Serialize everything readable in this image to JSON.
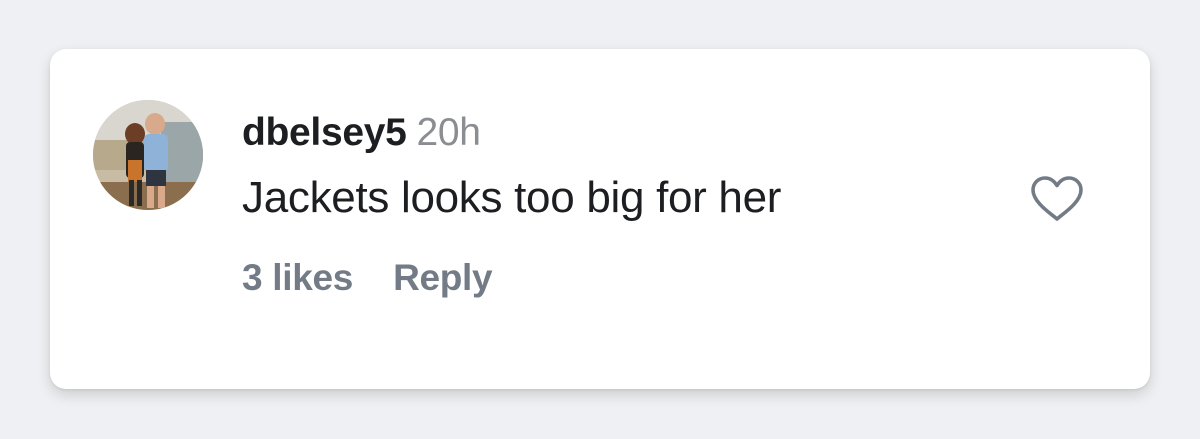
{
  "comment": {
    "username": "dbelsey5",
    "timestamp": "20h",
    "text": "Jackets looks too big for her",
    "likes_label": "3 likes",
    "reply_label": "Reply"
  },
  "icons": {
    "like": "heart-outline-icon",
    "avatar": "profile-photo"
  },
  "colors": {
    "background": "#eff0f3",
    "card": "#ffffff",
    "primary_text": "#1c1e21",
    "secondary_text": "#8a8d91",
    "action_text": "#737b86",
    "icon": "#737b86"
  }
}
